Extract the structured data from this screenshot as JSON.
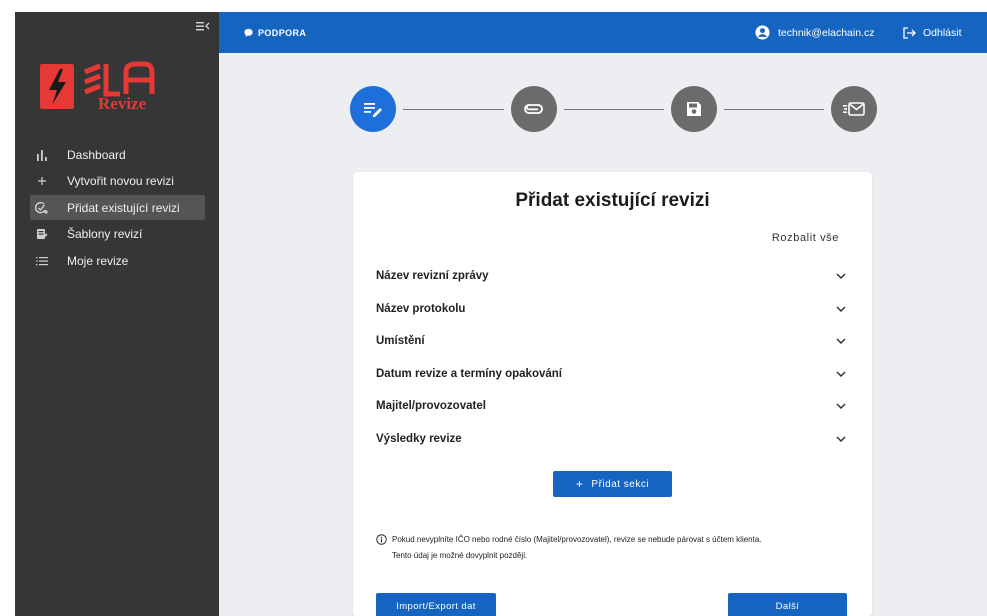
{
  "sidebar": {
    "logo_text": "ElA",
    "logo_subtitle": "Revize",
    "items": [
      {
        "label": "Dashboard",
        "icon": "bar-chart-icon"
      },
      {
        "label": "Vytvořit novou revizi",
        "icon": "plus-icon"
      },
      {
        "label": "Přidat existující revizi",
        "icon": "check-add-icon",
        "active": true
      },
      {
        "label": "Šablony revizí",
        "icon": "template-icon"
      },
      {
        "label": "Moje revize",
        "icon": "list-icon"
      }
    ]
  },
  "topbar": {
    "support_label": "PODPORA",
    "user_email": "technik@elachain.cz",
    "logout_label": "Odhlásit"
  },
  "stepper": {
    "steps": [
      {
        "icon": "edit-icon",
        "state": "done"
      },
      {
        "icon": "attachment-icon",
        "state": "todo"
      },
      {
        "icon": "save-icon",
        "state": "todo"
      },
      {
        "icon": "send-mail-icon",
        "state": "todo"
      }
    ]
  },
  "card": {
    "title": "Přidat existující revizi",
    "expand_all": "Rozbalit vše",
    "sections": [
      "Název revizní zprávy",
      "Název protokolu",
      "Umístění",
      "Datum revize a termíny opakování",
      "Majitel/provozovatel",
      "Výsledky revize"
    ],
    "add_section": "Přidat sekci",
    "info_line1": "Pokud nevyplníte IČO nebo rodné číslo (Majitel/provozovatel), revize se nebude párovat s účtem klienta.",
    "info_line2": "Tento údaj je možné dovyplnit později.",
    "import_export": "Import/Export dat",
    "next": "Další"
  },
  "colors": {
    "primary": "#1565c0",
    "sidebar_bg": "#363636",
    "content_bg": "#eceef2",
    "step_done": "#1e6fd9",
    "step_todo": "#6b6b6b",
    "logo_red": "#e53935"
  }
}
